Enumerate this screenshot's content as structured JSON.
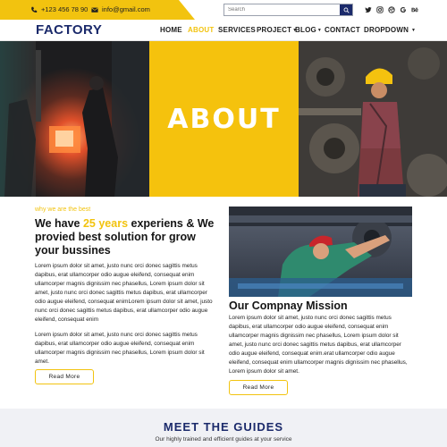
{
  "topbar": {
    "phone": "+123 456 78 90",
    "email": "info@gmail.com",
    "search_placeholder": "Search",
    "social": [
      "twitter-icon",
      "instagram-icon",
      "dribbble-icon",
      "google-icon",
      "behance-icon"
    ]
  },
  "nav": {
    "logo": "FACTORY",
    "items": [
      {
        "label": "HOME",
        "dropdown": false
      },
      {
        "label": "ABOUT",
        "dropdown": false,
        "active": true
      },
      {
        "label": "SERVICES",
        "dropdown": false
      },
      {
        "label": "PROJECT",
        "dropdown": true
      },
      {
        "label": "BLOG",
        "dropdown": true
      },
      {
        "label": "CONTACT",
        "dropdown": false
      },
      {
        "label": "DROPDOWN",
        "dropdown": true
      }
    ]
  },
  "hero": {
    "title": "ABOUT"
  },
  "about": {
    "kicker": "why we are the best",
    "headline_pre": "We have ",
    "headline_highlight": "25 years",
    "headline_post": " experiens & We provied best solution for grow your bussines",
    "paragraph_1": "Lorem ipsum dolor sit amet, justo nunc orci donec sagittis metus dapibus, erat ullamcorper odio augue eleifend, consequat enim ullamcorper magnis dignissim nec phasellus, Lorem ipsum dolor sit amet, justo nunc orci donec sagittis metus dapibus, erat ullamcorper odio augue eleifend, consequat enimLorem ipsum dolor sit amet, justo nunc orci donec sagittis metus dapibus, erat ullamcorper odio augue eleifend, consequat enim",
    "paragraph_2": "Lorem ipsum dolor sit amet, justo nunc orci donec sagittis metus dapibus, erat ullamcorper odio augue eleifend, consequat enim ullamcorper magnis dignissim nec phasellus, Lorem ipsum dolor sit amet.",
    "read_more": "Read More"
  },
  "mission": {
    "title": "Our Compnay Mission",
    "paragraph": "Lorem ipsum dolor sit amet, justo nunc orci donec sagittis metus dapibus, erat ullamcorper odio augue eleifend, consequat enim ullamcorper magnis dignissim nec phasellus, Lorem ipsum dolor sit amet, justo nunc orci donec sagittis metus dapibus, erat ullamcorper odio augue eleifend, consequat enim.erat ullamcorper odio augue eleifend, consequat enim ullamcorper magnis dignissim nec phasellus, Lorem ipsum dolor sit amet.",
    "read_more": "Read More"
  },
  "guides": {
    "title": "MEET THE GUIDES",
    "subtitle": "Our highly trained and efficient guides at your service"
  },
  "colors": {
    "accent": "#f2c30f",
    "brand": "#1b2a6b"
  }
}
